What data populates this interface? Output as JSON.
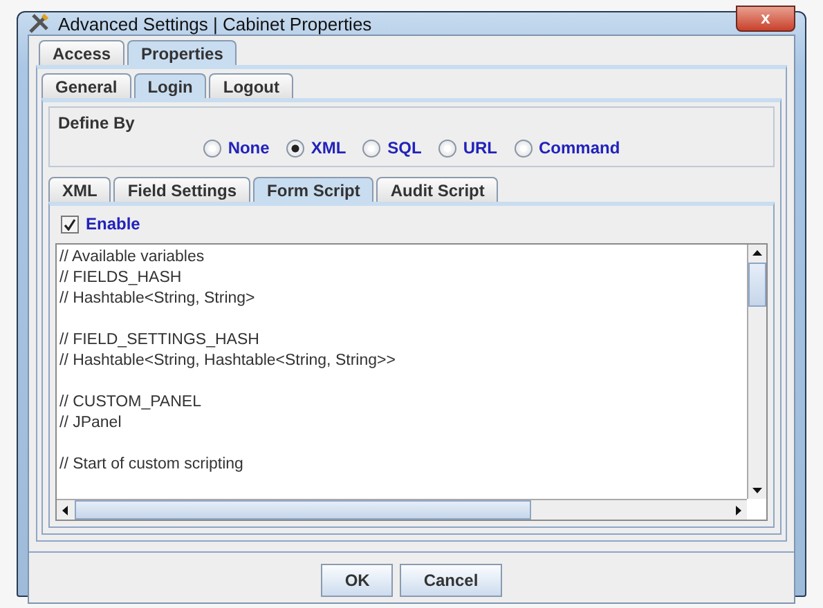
{
  "window": {
    "title": "Advanced Settings | Cabinet Properties",
    "close": "x"
  },
  "top_tabs": [
    {
      "label": "Access",
      "selected": false
    },
    {
      "label": "Properties",
      "selected": true
    }
  ],
  "section_tabs": [
    {
      "label": "General",
      "selected": false
    },
    {
      "label": "Login",
      "selected": true
    },
    {
      "label": "Logout",
      "selected": false
    }
  ],
  "define_by": {
    "title": "Define By",
    "options": [
      {
        "label": "None",
        "selected": false
      },
      {
        "label": "XML",
        "selected": true
      },
      {
        "label": "SQL",
        "selected": false
      },
      {
        "label": "URL",
        "selected": false
      },
      {
        "label": "Command",
        "selected": false
      }
    ]
  },
  "script_tabs": [
    {
      "label": "XML",
      "selected": false
    },
    {
      "label": "Field Settings",
      "selected": false
    },
    {
      "label": "Form Script",
      "selected": true
    },
    {
      "label": "Audit Script",
      "selected": false
    }
  ],
  "enable": {
    "label": "Enable",
    "checked": true
  },
  "editor": {
    "blocks": [
      [
        "// Available variables",
        "// FIELDS_HASH",
        "// Hashtable<String, String>"
      ],
      [
        "// FIELD_SETTINGS_HASH",
        "// Hashtable<String, Hashtable<String, String>>"
      ],
      [
        "// CUSTOM_PANEL",
        "// JPanel"
      ],
      [
        "// Start of custom scripting"
      ]
    ]
  },
  "buttons": [
    "OK",
    "Cancel"
  ]
}
